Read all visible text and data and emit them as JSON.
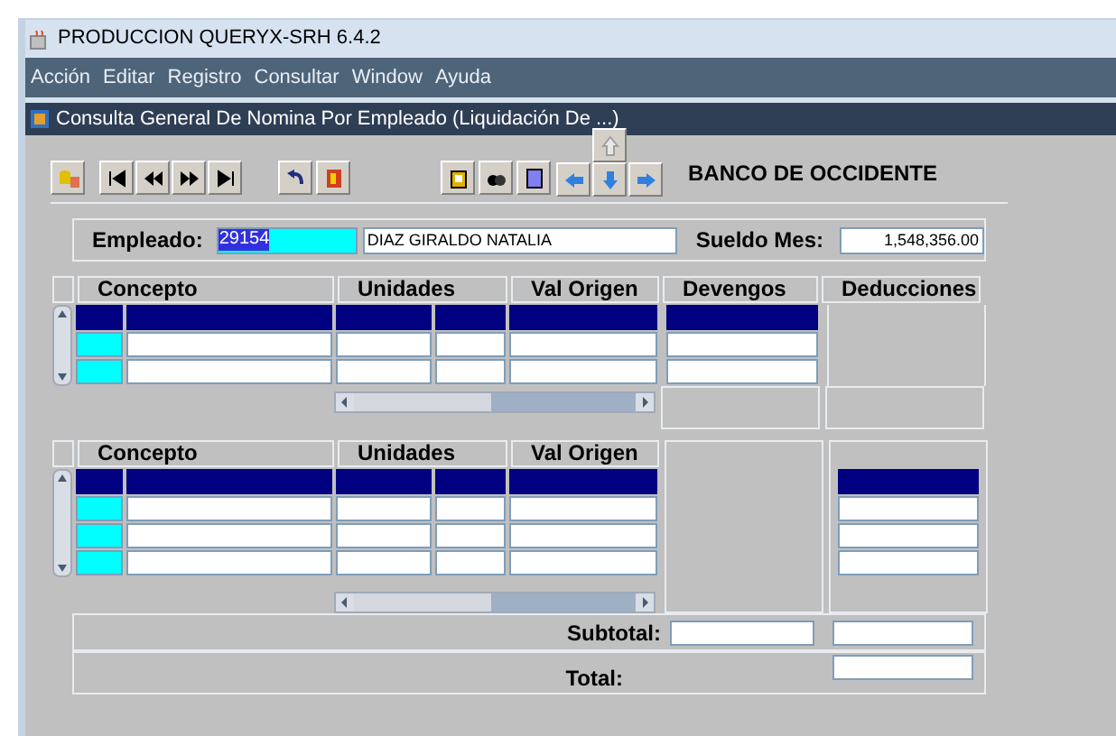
{
  "window": {
    "title": "PRODUCCION QUERYX-SRH 6.4.2"
  },
  "menu": [
    "Acción",
    "Editar",
    "Registro",
    "Consultar",
    "Window",
    "Ayuda"
  ],
  "form": {
    "title": "Consulta General De Nomina Por Empleado (Liquidación De ...)"
  },
  "bank": "BANCO DE OCCIDENTE",
  "employee": {
    "label": "Empleado:",
    "code": "29154",
    "code_selected": true,
    "name": "DIAZ GIRALDO NATALIA",
    "salary_label": "Sueldo Mes:",
    "salary": "1,548,356.00"
  },
  "table_1": {
    "columns": [
      "Concepto",
      "Unidades",
      "Val Origen",
      "Devengos",
      "Deducciones"
    ],
    "rows": [
      {
        "selected": true
      },
      {
        "selected": false
      },
      {
        "selected": false
      }
    ]
  },
  "table_2": {
    "columns": [
      "Concepto",
      "Unidades",
      "Val Origen"
    ],
    "rows": [
      {
        "selected": true
      },
      {
        "selected": false
      },
      {
        "selected": false
      },
      {
        "selected": false
      }
    ]
  },
  "subtotal": {
    "label": "Subtotal:"
  },
  "total": {
    "label": "Total:"
  }
}
